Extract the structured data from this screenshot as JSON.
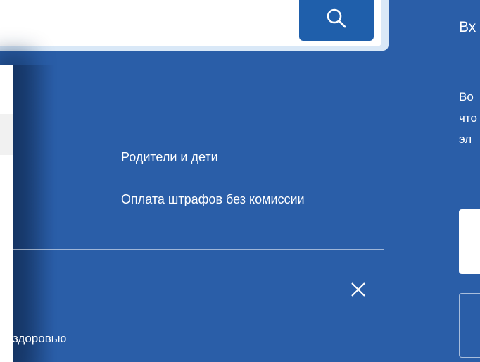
{
  "search": {
    "placeholder": "",
    "button_icon": "search-icon"
  },
  "menu": {
    "links": [
      "Родители и дети",
      "Оплата штрафов без комиссии"
    ],
    "close_icon": "close-icon",
    "bottom_partial_text": "здоровью"
  },
  "login_panel": {
    "title_partial": "Вх",
    "text_partial_lines": [
      "Во",
      "что",
      "эл"
    ]
  },
  "colors": {
    "background": "#2a5ea8",
    "search_button": "#1f5fab",
    "search_border": "#d9e8f7"
  }
}
